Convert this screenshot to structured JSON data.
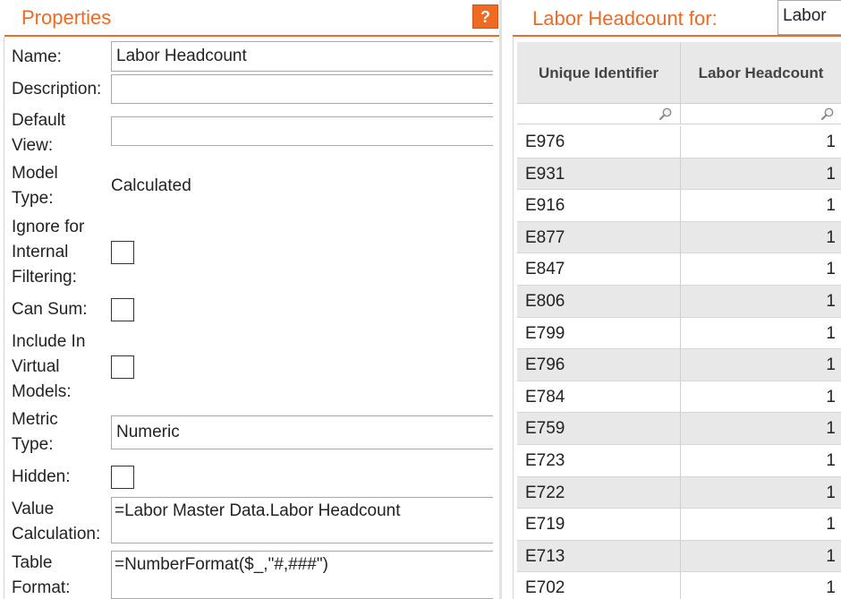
{
  "properties": {
    "title": "Properties",
    "help_label": "?",
    "fields": {
      "name": {
        "label": "Name:",
        "value": "Labor Headcount"
      },
      "description": {
        "label": "Description:",
        "value": ""
      },
      "default_view": {
        "label_line1": "Default",
        "label_line2": "View:",
        "value": ""
      },
      "model_type": {
        "label_line1": "Model",
        "label_line2": "Type:",
        "value": "Calculated"
      },
      "ignore_filtering": {
        "label_line1": "Ignore for",
        "label_line2": "Internal",
        "label_line3": "Filtering:",
        "checked": false
      },
      "can_sum": {
        "label": "Can Sum:",
        "checked": false
      },
      "include_virtual": {
        "label_line1": "Include In",
        "label_line2": "Virtual",
        "label_line3": "Models:",
        "checked": false
      },
      "metric_type": {
        "label_line1": "Metric",
        "label_line2": "Type:",
        "value": "Numeric"
      },
      "hidden": {
        "label": "Hidden:",
        "checked": false
      },
      "value_calculation": {
        "label_line1": "Value",
        "label_line2": "Calculation:",
        "value": "=Labor Master Data.Labor Headcount"
      },
      "table_format": {
        "label_line1": "Table",
        "label_line2": "Format:",
        "value": "=NumberFormat($_,\"#,###\")"
      }
    }
  },
  "preview": {
    "title": "Labor Headcount for:",
    "model_select_value": "Labor",
    "columns": [
      "Unique Identifier",
      "Labor Headcount"
    ],
    "rows": [
      [
        "E976",
        "1"
      ],
      [
        "E931",
        "1"
      ],
      [
        "E916",
        "1"
      ],
      [
        "E877",
        "1"
      ],
      [
        "E847",
        "1"
      ],
      [
        "E806",
        "1"
      ],
      [
        "E799",
        "1"
      ],
      [
        "E796",
        "1"
      ],
      [
        "E784",
        "1"
      ],
      [
        "E759",
        "1"
      ],
      [
        "E723",
        "1"
      ],
      [
        "E722",
        "1"
      ],
      [
        "E719",
        "1"
      ],
      [
        "E713",
        "1"
      ],
      [
        "E702",
        "1"
      ]
    ]
  },
  "colors": {
    "accent": "#f06a22",
    "row_alt": "#e8e8e8",
    "header_bg": "#e8e8e8"
  },
  "icons": {
    "help": "question-icon",
    "filter": "search-icon"
  }
}
